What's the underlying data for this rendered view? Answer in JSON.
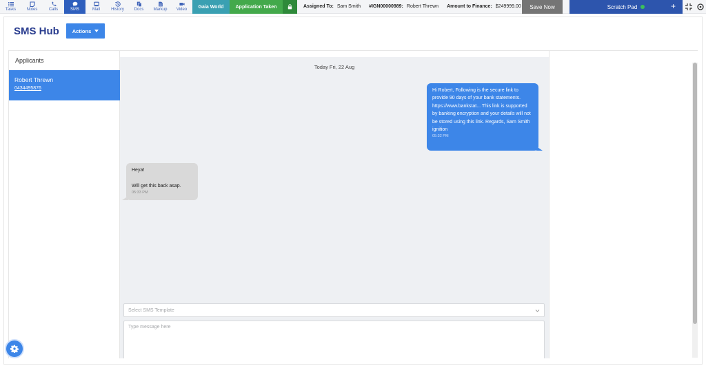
{
  "toolbar": {
    "tools": [
      {
        "label": "Tasks",
        "icon": "list-icon"
      },
      {
        "label": "Notes",
        "icon": "note-icon"
      },
      {
        "label": "Calls",
        "icon": "phone-icon"
      },
      {
        "label": "SMS",
        "icon": "chat-bubble-icon",
        "active": true
      },
      {
        "label": "Mail",
        "icon": "mail-icon"
      },
      {
        "label": "History",
        "icon": "history-icon"
      },
      {
        "label": "Docs",
        "icon": "documents-icon"
      },
      {
        "label": "Markup",
        "icon": "markup-icon"
      },
      {
        "label": "Video",
        "icon": "video-camera-icon"
      }
    ],
    "gaia_label": "Gaia World",
    "status_label": "Application Taken",
    "assigned_label": "Assigned To:",
    "assigned_value": "Sam Smith",
    "ref_label": "#IGN00000989:",
    "ref_value": "Robert Threwn",
    "amount_label": "Amount to Finance:",
    "amount_value": "$249999.00",
    "save_label": "Save Now",
    "scratch_label": "Scratch Pad",
    "scratch_plus": "+"
  },
  "header": {
    "title": "SMS Hub",
    "actions_label": "Actions"
  },
  "applicants": {
    "title": "Applicants",
    "items": [
      {
        "name": "Robert Threwn",
        "phone": "0434495876"
      }
    ]
  },
  "chat": {
    "date": "Today Fri, 22 Aug",
    "messages": [
      {
        "direction": "outgoing",
        "text": "Hi Robert, Following is the secure link to provide 90 days of your bank statements. https://www.bankstat... This link is supported by banking encryption and your details will not be stored using this link. Regards, Sam Smith ignition",
        "time": "05:32 PM"
      },
      {
        "direction": "incoming",
        "text": "Heya!\n\nWill get this back asap.",
        "time": "05:33 PM"
      }
    ]
  },
  "composer": {
    "template_placeholder": "Select SMS Template",
    "message_placeholder": "Type message here"
  },
  "colors": {
    "accent": "#3d86e8",
    "brand_dark": "#2a3d8f",
    "status_green": "#43a94b",
    "gaia_teal": "#3aa0b2"
  }
}
